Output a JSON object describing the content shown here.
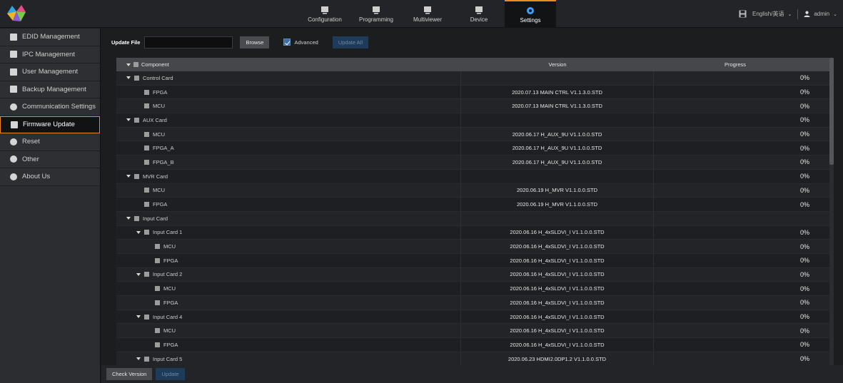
{
  "topnav": {
    "items": [
      {
        "label": "Configuration",
        "icon": "configuration-icon"
      },
      {
        "label": "Programming",
        "icon": "programming-icon"
      },
      {
        "label": "Multiviewer",
        "icon": "multiviewer-icon"
      },
      {
        "label": "Device",
        "icon": "device-icon"
      },
      {
        "label": "Settings",
        "icon": "settings-icon",
        "active": true
      }
    ],
    "language": "English/英语",
    "user": "admin"
  },
  "sidebar": {
    "items": [
      {
        "label": "EDID Management",
        "icon": "edid-icon"
      },
      {
        "label": "IPC Management",
        "icon": "ipc-icon"
      },
      {
        "label": "User Management",
        "icon": "user-icon"
      },
      {
        "label": "Backup Management",
        "icon": "backup-icon"
      },
      {
        "label": "Communication Settings",
        "icon": "communication-icon"
      },
      {
        "label": "Firmware Update",
        "icon": "rocket-icon",
        "active": true
      },
      {
        "label": "Reset",
        "icon": "reset-icon"
      },
      {
        "label": "Other",
        "icon": "other-icon"
      },
      {
        "label": "About Us",
        "icon": "info-icon"
      }
    ]
  },
  "toolbar": {
    "update_file_label": "Update File",
    "update_file_value": "",
    "browse_label": "Browse",
    "advanced_label": "Advanced",
    "advanced_checked": true,
    "update_all_label": "Update All"
  },
  "table": {
    "headers": {
      "component": "Component",
      "version": "Version",
      "progress": "Progress"
    },
    "rows": [
      {
        "level": 1,
        "expand": true,
        "name": "Control Card",
        "version": "",
        "progress": "0%"
      },
      {
        "level": 2,
        "expand": false,
        "name": "FPGA",
        "version": "2020.07.13 MAIN CTRL V1.1.3.0.STD",
        "progress": "0%"
      },
      {
        "level": 2,
        "expand": false,
        "name": "MCU",
        "version": "2020.07.13 MAIN CTRL V1.1.3.0.STD",
        "progress": "0%"
      },
      {
        "level": 1,
        "expand": true,
        "name": "AUX Card",
        "version": "",
        "progress": "0%"
      },
      {
        "level": 2,
        "expand": false,
        "name": "MCU",
        "version": "2020.06.17 H_AUX_9U V1.1.0.0.STD",
        "progress": "0%"
      },
      {
        "level": 2,
        "expand": false,
        "name": "FPGA_A",
        "version": "2020.06.17 H_AUX_9U V1.1.0.0.STD",
        "progress": "0%"
      },
      {
        "level": 2,
        "expand": false,
        "name": "FPGA_B",
        "version": "2020.06.17 H_AUX_9U V1.1.0.0.STD",
        "progress": "0%"
      },
      {
        "level": 1,
        "expand": true,
        "name": "MVR Card",
        "version": "",
        "progress": "0%"
      },
      {
        "level": 2,
        "expand": false,
        "name": "MCU",
        "version": "2020.06.19 H_MVR V1.1.0.0.STD",
        "progress": "0%"
      },
      {
        "level": 2,
        "expand": false,
        "name": "FPGA",
        "version": "2020.06.19 H_MVR V1.1.0.0.STD",
        "progress": "0%"
      },
      {
        "level": 1,
        "expand": true,
        "name": "Input Card",
        "version": "",
        "progress": ""
      },
      {
        "level": 2,
        "expand": true,
        "name": "Input Card 1",
        "version": "2020.06.16 H_4xSLDVI_I V1.1.0.0.STD",
        "progress": "0%"
      },
      {
        "level": 3,
        "expand": false,
        "name": "MCU",
        "version": "2020.06.16 H_4xSLDVI_I V1.1.0.0.STD",
        "progress": "0%"
      },
      {
        "level": 3,
        "expand": false,
        "name": "FPGA",
        "version": "2020.06.16 H_4xSLDVI_I V1.1.0.0.STD",
        "progress": "0%"
      },
      {
        "level": 2,
        "expand": true,
        "name": "Input Card 2",
        "version": "2020.06.16 H_4xSLDVI_I V1.1.0.0.STD",
        "progress": "0%"
      },
      {
        "level": 3,
        "expand": false,
        "name": "MCU",
        "version": "2020.06.16 H_4xSLDVI_I V1.1.0.0.STD",
        "progress": "0%"
      },
      {
        "level": 3,
        "expand": false,
        "name": "FPGA",
        "version": "2020.06.16 H_4xSLDVI_I V1.1.0.0.STD",
        "progress": "0%"
      },
      {
        "level": 2,
        "expand": true,
        "name": "Input Card 4",
        "version": "2020.06.16 H_4xSLDVI_I V1.1.0.0.STD",
        "progress": "0%"
      },
      {
        "level": 3,
        "expand": false,
        "name": "MCU",
        "version": "2020.06.16 H_4xSLDVI_I V1.1.0.0.STD",
        "progress": "0%"
      },
      {
        "level": 3,
        "expand": false,
        "name": "FPGA",
        "version": "2020.06.16 H_4xSLDVI_I V1.1.0.0.STD",
        "progress": "0%"
      },
      {
        "level": 2,
        "expand": true,
        "name": "Input Card 5",
        "version": "2020.06.23 HDMI2.0DP1.2 V1.1.0.0.STD",
        "progress": "0%"
      }
    ]
  },
  "footer": {
    "check_version_label": "Check Version",
    "update_label": "Update"
  },
  "colors": {
    "accent": "#e98a1f",
    "primary_disabled": "#1e3b5a",
    "background": "#1b1c1e"
  }
}
